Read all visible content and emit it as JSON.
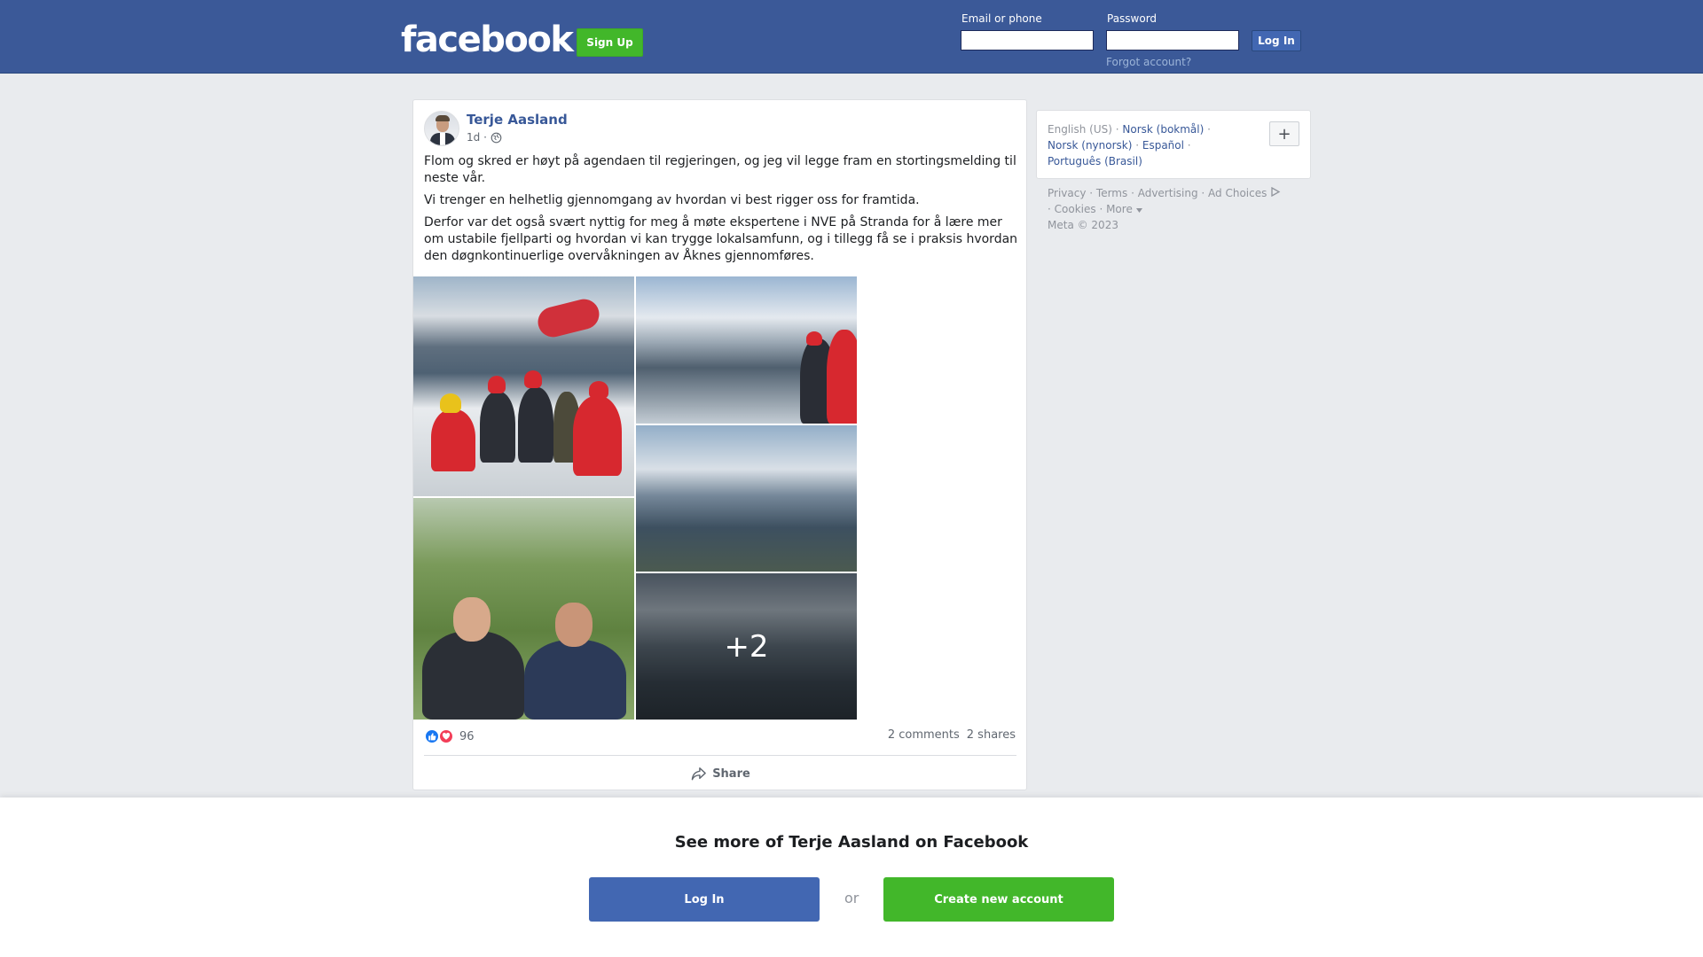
{
  "header": {
    "logo": "facebook",
    "signup_label": "Sign Up",
    "email_label": "Email or phone",
    "password_label": "Password",
    "login_label": "Log In",
    "forgot_label": "Forgot account?"
  },
  "post": {
    "author": "Terje Aasland",
    "time": "1d ·",
    "paragraphs": [
      "Flom og skred er høyt på agendaen til regjeringen, og jeg vil legge fram en stortingsmelding til neste vår.",
      "Vi trenger en helhetlig gjennomgang av hvordan vi best rigger oss for framtida.",
      "Derfor var det også svært nyttig for meg å møte ekspertene i NVE på Stranda for å lære mer om ustabile fjellparti og hvordan vi kan trygge lokalsamfunn, og i tillegg få se i praksis hvordan den døgnkontinuerlige overvåkningen av Åknes gjennomføres."
    ],
    "more_photos": "+2",
    "reaction_count": "96",
    "comments": "2 comments",
    "shares": "2 shares",
    "share_label": "Share"
  },
  "sidebar": {
    "current_language": "English (US) ·",
    "languages": [
      "Norsk (bokmål)",
      "Norsk (nynorsk)",
      "Español",
      "Português (Brasil)"
    ],
    "plus_label": "+",
    "footer": [
      "Privacy",
      "Terms",
      "Advertising",
      "Ad Choices",
      "Cookies",
      "More"
    ],
    "copyright": "Meta © 2023"
  },
  "bottom": {
    "title": "See more of Terje Aasland on Facebook",
    "login_label": "Log In",
    "or_label": "or",
    "create_label": "Create new account"
  },
  "colors": {
    "brand_blue": "#3b5998",
    "button_blue": "#4267b2",
    "green": "#42b72a",
    "link": "#385898"
  }
}
